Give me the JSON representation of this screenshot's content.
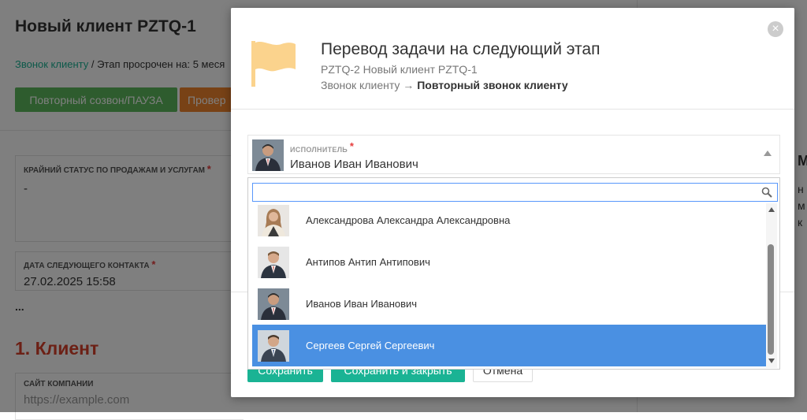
{
  "background": {
    "page_title": "Новый клиент PZTQ-1",
    "breadcrumb_link": "Звонок клиенту",
    "breadcrumb_rest": " / Этап просрочен на: 5 меся",
    "btn_green": "Повторный созвон/ПАУЗА",
    "btn_orange": "Провер",
    "field1_label": "КРАЙНИЙ СТАТУС ПО ПРОДАЖАМ И УСЛУГАМ",
    "field1_value": "-",
    "field2_label": "ДАТА СЛЕДУЮЩЕГО КОНТАКТА",
    "field2_value": "27.02.2025 15:58",
    "ellipsis": "...",
    "section_title": "1. Клиент",
    "field3_label": "САЙТ КОМПАНИИ",
    "field3_placeholder": "https://example.com",
    "right_chars": [
      "М",
      "н",
      "м",
      "к"
    ],
    "required_mark": "*"
  },
  "modal": {
    "title": "Перевод задачи на следующий этап",
    "subtitle": "PZTQ-2 Новый клиент PZTQ-1",
    "from_stage": "Звонок клиенту",
    "arrow": " → ",
    "to_stage": "Повторный звонок клиенту",
    "close_glyph": "×",
    "field_label": "ИСПОЛНИТЕЛЬ",
    "required_mark": "*",
    "selected_value": "Иванов Иван Иванович",
    "search_value": "",
    "options": [
      "Александрова Александра Александровна",
      "Антипов Антип Антипович",
      "Иванов Иван Иванович",
      "Сергеев Сергей Сергеевич"
    ],
    "highlighted_option": "Сергеев Сергей Сергеевич",
    "footer": {
      "save": "Сохранить",
      "save_close": "Сохранить и закрыть",
      "cancel": "Отмена"
    }
  },
  "colors": {
    "accent_green": "#1ab394",
    "highlight_blue": "#4a90e2",
    "flag_yellow": "#fbd38d",
    "required_red": "#e63c3c"
  },
  "icons": {
    "flag": "flag-icon",
    "close": "close-icon",
    "search": "search-icon",
    "dropdown": "chevron-up-icon"
  }
}
